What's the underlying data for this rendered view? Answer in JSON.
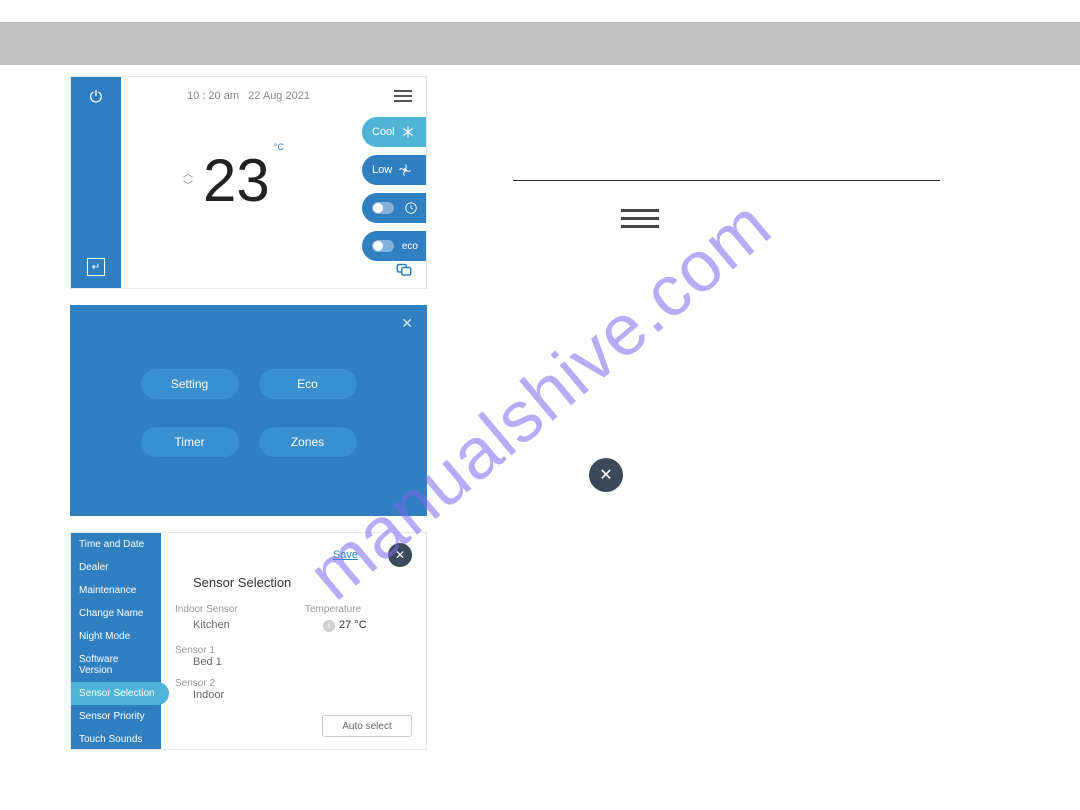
{
  "watermark": "manualshive.com",
  "panel1": {
    "time": "10 : 20 am",
    "date": "22 Aug 2021",
    "temp": "23",
    "unit": "°C",
    "pills": {
      "cool": "Cool",
      "low": "Low",
      "eco": "eco"
    }
  },
  "panel2": {
    "buttons": {
      "setting": "Setting",
      "eco": "Eco",
      "timer": "Timer",
      "zones": "Zones"
    }
  },
  "panel3": {
    "save": "Save",
    "title": "Sensor Selection",
    "sidebar": [
      "Time and Date",
      "Dealer",
      "Maintenance",
      "Change Name",
      "Night Mode",
      "Software Version",
      "Sensor Selection",
      "Sensor Priority",
      "Touch Sounds"
    ],
    "indoor_label": "Indoor Sensor",
    "temperature_label": "Temperature",
    "indoor_value": "Kitchen",
    "indoor_temp": "27 °C",
    "sensor1_label": "Sensor 1",
    "sensor1_value": "Bed 1",
    "sensor2_label": "Sensor 2",
    "sensor2_value": "Indoor",
    "autoselect": "Auto select"
  }
}
